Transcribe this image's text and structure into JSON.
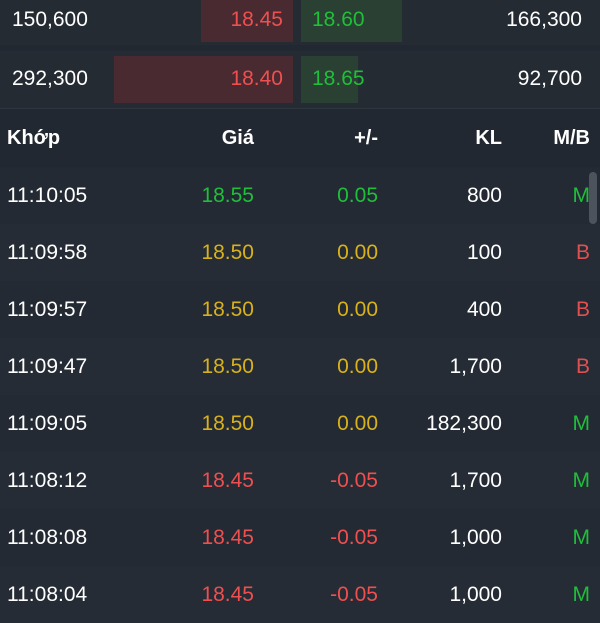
{
  "order_book": [
    {
      "bid_volume": "150,600",
      "bid_price": "18.45",
      "ask_price": "18.60",
      "ask_volume": "166,300"
    },
    {
      "bid_volume": "292,300",
      "bid_price": "18.40",
      "ask_price": "18.65",
      "ask_volume": "92,700"
    }
  ],
  "trades": {
    "headers": {
      "time": "Khớp",
      "price": "Giá",
      "change": "+/-",
      "volume": "KL",
      "side": "M/B"
    },
    "rows": [
      {
        "time": "11:10:05",
        "price": "18.55",
        "change": "0.05",
        "volume": "800",
        "side": "M",
        "trend": "up"
      },
      {
        "time": "11:09:58",
        "price": "18.50",
        "change": "0.00",
        "volume": "100",
        "side": "B",
        "trend": "ref"
      },
      {
        "time": "11:09:57",
        "price": "18.50",
        "change": "0.00",
        "volume": "400",
        "side": "B",
        "trend": "ref"
      },
      {
        "time": "11:09:47",
        "price": "18.50",
        "change": "0.00",
        "volume": "1,700",
        "side": "B",
        "trend": "ref"
      },
      {
        "time": "11:09:05",
        "price": "18.50",
        "change": "0.00",
        "volume": "182,300",
        "side": "M",
        "trend": "ref"
      },
      {
        "time": "11:08:12",
        "price": "18.45",
        "change": "-0.05",
        "volume": "1,700",
        "side": "M",
        "trend": "down"
      },
      {
        "time": "11:08:08",
        "price": "18.45",
        "change": "-0.05",
        "volume": "1,000",
        "side": "M",
        "trend": "down"
      },
      {
        "time": "11:08:04",
        "price": "18.45",
        "change": "-0.05",
        "volume": "1,000",
        "side": "M",
        "trend": "down"
      }
    ]
  },
  "colors": {
    "up": "#1fbf3a",
    "reference": "#d8b11b",
    "down": "#ef4f4f",
    "background": "#222831"
  }
}
